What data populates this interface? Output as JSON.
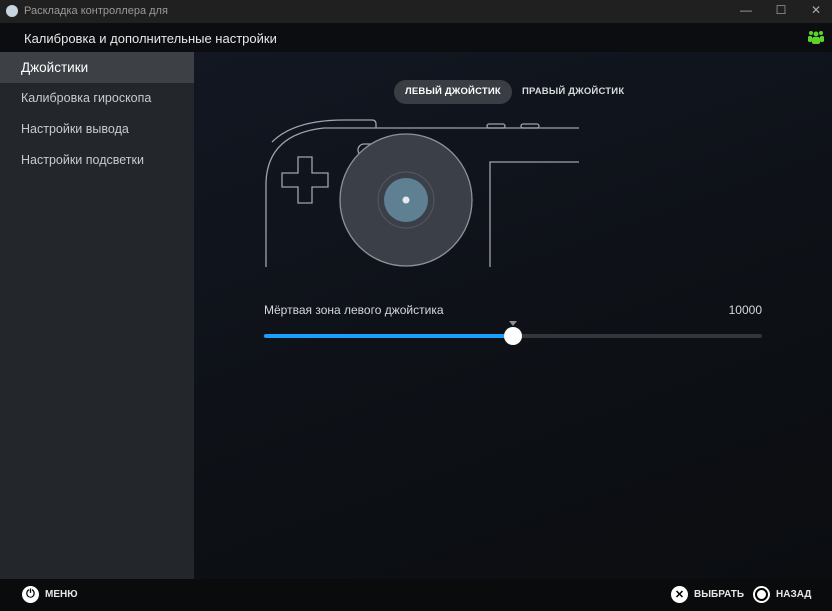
{
  "window": {
    "title": "Раскладка контроллера для",
    "min": "—",
    "max": "☐",
    "close": "✕"
  },
  "header": {
    "title": "Калибровка и дополнительные настройки"
  },
  "sidebar": {
    "items": [
      {
        "label": "Джойстики",
        "active": true
      },
      {
        "label": "Калибровка гироскопа"
      },
      {
        "label": "Настройки вывода"
      },
      {
        "label": "Настройки подсветки"
      }
    ]
  },
  "tabs": [
    {
      "label": "ЛЕВЫЙ ДЖОЙСТИК",
      "active": true
    },
    {
      "label": "ПРАВЫЙ ДЖОЙСТИК"
    }
  ],
  "slider": {
    "label": "Мёртвая зона левого джойстика",
    "value": "10000",
    "fill_percent": 50
  },
  "footer": {
    "menu": "МЕНЮ",
    "select": "ВЫБРАТЬ",
    "back": "НАЗАД"
  },
  "colors": {
    "accent": "#1a9fff",
    "friends": "#5bd32e"
  }
}
